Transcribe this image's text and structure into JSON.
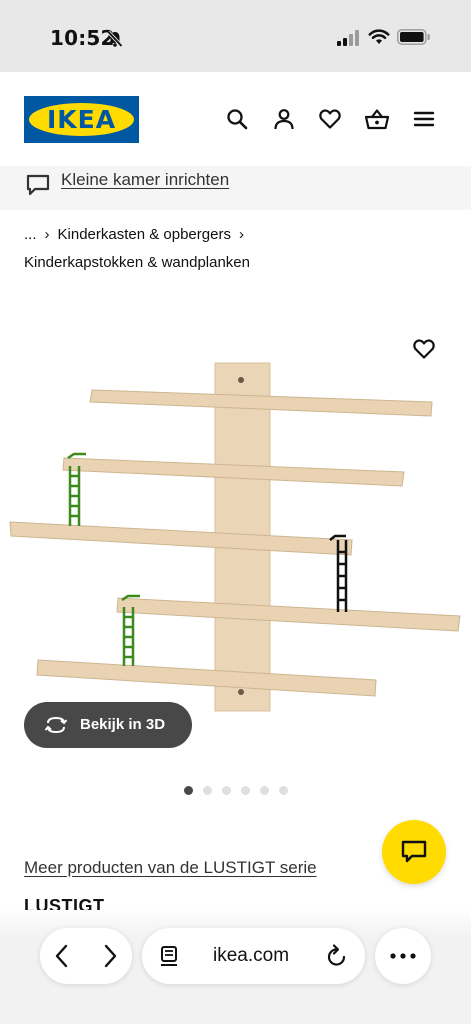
{
  "status_bar": {
    "time": "10:52",
    "icons": [
      "bell-slash-icon",
      "signal-icon",
      "wifi-icon",
      "battery-icon"
    ]
  },
  "header": {
    "logo_text": "IKEA",
    "icons": [
      "search-icon",
      "account-icon",
      "heart-icon",
      "basket-icon",
      "menu-icon"
    ],
    "colors": {
      "logo_blue": "#0058a3",
      "logo_yellow": "#ffdb00"
    }
  },
  "banner": {
    "icon": "chat-bubble-icon",
    "link_text": "Kleine kamer inrichten"
  },
  "breadcrumb": {
    "ellipsis": "...",
    "separator": "›",
    "level1": "Kinderkasten & opbergers",
    "level2": "Kinderkapstokken & wandplanken"
  },
  "product": {
    "image_alt": "LUSTIGT wandplank",
    "view_3d_label": "Bekijk in 3D",
    "carousel": {
      "count": 6,
      "active_index": 0
    },
    "series_link": "Meer producten van de LUSTIGT serie",
    "name": "LUSTIGT"
  },
  "chat_fab": {
    "icon": "chat-icon",
    "color": "#ffdb00"
  },
  "browser_bar": {
    "url": "ikea.com",
    "icons": [
      "back-icon",
      "forward-icon",
      "reader-icon",
      "reload-icon",
      "more-icon"
    ]
  }
}
